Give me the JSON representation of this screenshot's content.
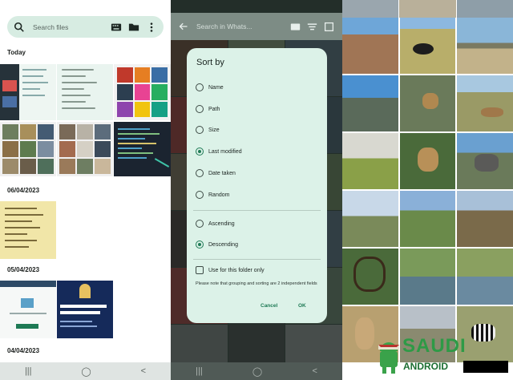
{
  "left_panel": {
    "search_placeholder": "Search files",
    "sections": [
      "Today",
      "06/04/2023",
      "05/04/2023",
      "04/04/2023"
    ],
    "nav_buttons": [
      "|||",
      "◯",
      "<"
    ]
  },
  "middle_panel": {
    "search_placeholder": "Search in Whats...",
    "dialog": {
      "title": "Sort by",
      "options": [
        "Name",
        "Path",
        "Size",
        "Last modified",
        "Date taken",
        "Random"
      ],
      "selected_option": "Last modified",
      "order_options": [
        "Ascending",
        "Descending"
      ],
      "selected_order": "Descending",
      "checkbox_label": "Use for this folder only",
      "checkbox_checked": false,
      "note": "Please note that grouping and sorting are 2 independent fields",
      "cancel_label": "Cancel",
      "ok_label": "OK"
    },
    "nav_buttons": [
      "|||",
      "◯",
      "<"
    ]
  },
  "right_panel": {
    "watermark_top": "SAUDI",
    "watermark_bottom": "ANDROID"
  },
  "colors": {
    "accent": "#1e7a55",
    "dialog_bg": "#dcf2e8",
    "search_bg": "#d7ece2"
  }
}
